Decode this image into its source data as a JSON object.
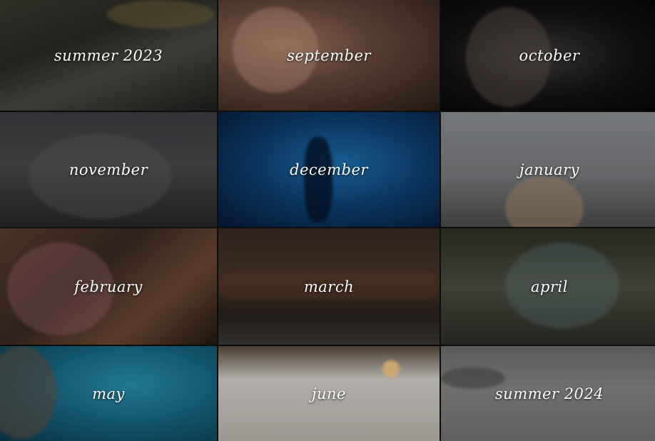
{
  "tiles": [
    {
      "label": "summer 2023"
    },
    {
      "label": "september"
    },
    {
      "label": "october"
    },
    {
      "label": "november"
    },
    {
      "label": "december"
    },
    {
      "label": "january"
    },
    {
      "label": "february"
    },
    {
      "label": "march"
    },
    {
      "label": "april"
    },
    {
      "label": "may"
    },
    {
      "label": "june"
    },
    {
      "label": "summer 2024"
    }
  ]
}
